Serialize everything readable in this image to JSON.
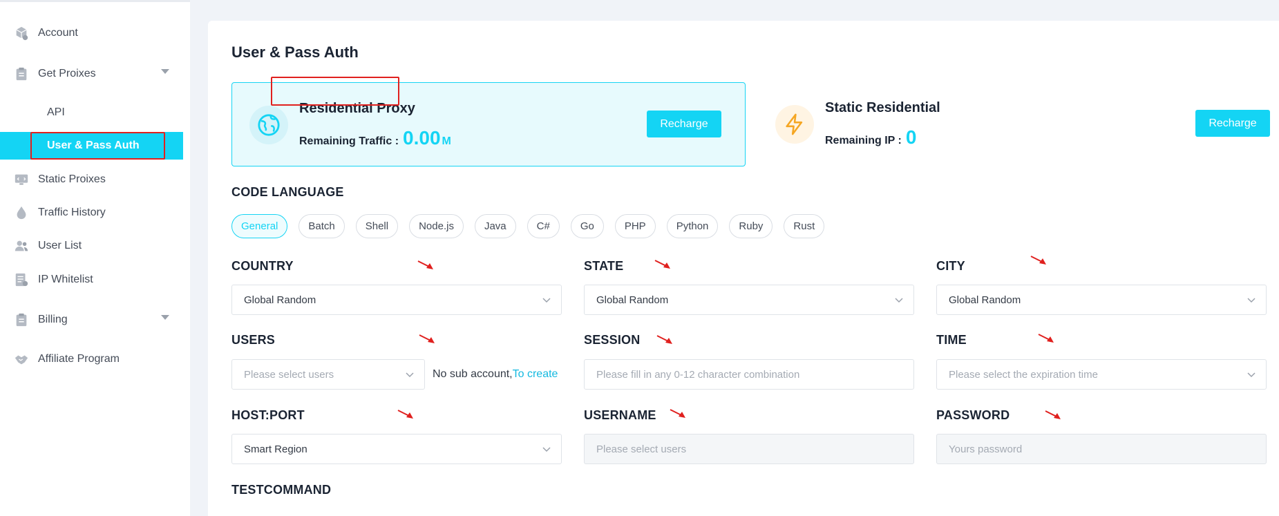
{
  "sidebar": {
    "items": [
      {
        "label": "Account",
        "icon": "cube-icon"
      },
      {
        "label": "Get Proixes",
        "icon": "clipboard-icon"
      },
      {
        "label": "API"
      },
      {
        "label": "User & Pass Auth"
      },
      {
        "label": "Static Proixes",
        "icon": "monitor-icon"
      },
      {
        "label": "Traffic History",
        "icon": "droplet-icon"
      },
      {
        "label": "User List",
        "icon": "users-icon"
      },
      {
        "label": "IP Whitelist",
        "icon": "list-icon"
      },
      {
        "label": "Billing",
        "icon": "clipboard-icon"
      },
      {
        "label": "Affiliate Program",
        "icon": "handshake-icon"
      }
    ]
  },
  "main": {
    "title": "User & Pass Auth",
    "cards": [
      {
        "name": "Residential Proxy",
        "remain_label": "Remaining Traffic :",
        "value": "0.00",
        "unit": "M",
        "button": "Recharge"
      },
      {
        "name": "Static Residential",
        "remain_label": "Remaining IP :",
        "value": "0",
        "unit": "",
        "button": "Recharge"
      }
    ],
    "code_language": {
      "label": "CODE LANGUAGE",
      "options": [
        "General",
        "Batch",
        "Shell",
        "Node.js",
        "Java",
        "C#",
        "Go",
        "PHP",
        "Python",
        "Ruby",
        "Rust"
      ],
      "selected": "General"
    },
    "fields": {
      "country": {
        "label": "COUNTRY",
        "value": "Global Random"
      },
      "state": {
        "label": "STATE",
        "value": "Global Random"
      },
      "city": {
        "label": "CITY",
        "value": "Global Random"
      },
      "users": {
        "label": "USERS",
        "placeholder": "Please select users",
        "note": "No sub account,",
        "note_link": "To create"
      },
      "session": {
        "label": "SESSION",
        "placeholder": "Please fill in any 0-12 character combination"
      },
      "time": {
        "label": "TIME",
        "placeholder": "Please select the expiration time"
      },
      "hostport": {
        "label": "HOST:PORT",
        "value": "Smart Region"
      },
      "username": {
        "label": "USERNAME",
        "placeholder": "Please select users"
      },
      "password": {
        "label": "PASSWORD",
        "placeholder": "Yours password"
      },
      "testcommand": {
        "label": "TESTCOMMAND"
      }
    }
  },
  "colors": {
    "accent": "#14d4f4",
    "annotation": "#e0201e",
    "static_icon": "#f5a623"
  }
}
